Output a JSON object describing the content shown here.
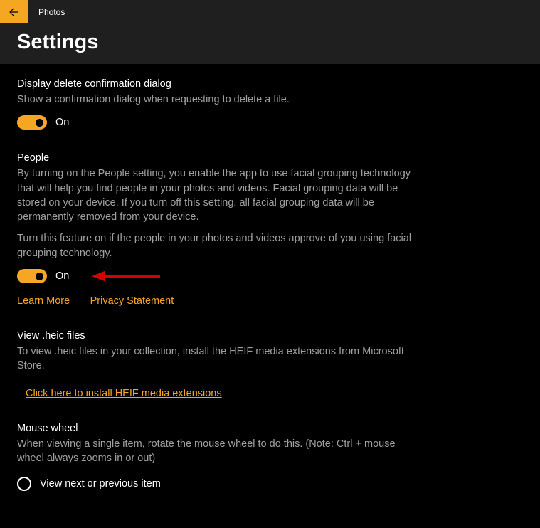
{
  "app": {
    "title": "Photos"
  },
  "page": {
    "title": "Settings"
  },
  "sections": {
    "delete_confirm": {
      "title": "Display delete confirmation dialog",
      "desc": "Show a confirmation dialog when requesting to delete a file.",
      "toggle_state": "On"
    },
    "people": {
      "title": "People",
      "desc": "By turning on the People setting, you enable the app to use facial grouping technology that will help you find people in your photos and videos. Facial grouping data will be stored on your device. If you turn off this setting, all facial grouping data will be permanently removed from your device.",
      "desc2": "Turn this feature on if the people in your photos and videos approve of you using facial grouping technology.",
      "toggle_state": "On",
      "learn_more": "Learn More",
      "privacy": "Privacy Statement"
    },
    "heic": {
      "title": "View .heic files",
      "desc": "To view .heic files in your collection, install the HEIF media extensions from Microsoft Store.",
      "link": "Click here to install HEIF media extensions"
    },
    "mouse_wheel": {
      "title": "Mouse wheel",
      "desc": "When viewing a single item, rotate the mouse wheel to do this. (Note: Ctrl + mouse wheel always zooms in or out)",
      "option1": "View next or previous item"
    }
  }
}
